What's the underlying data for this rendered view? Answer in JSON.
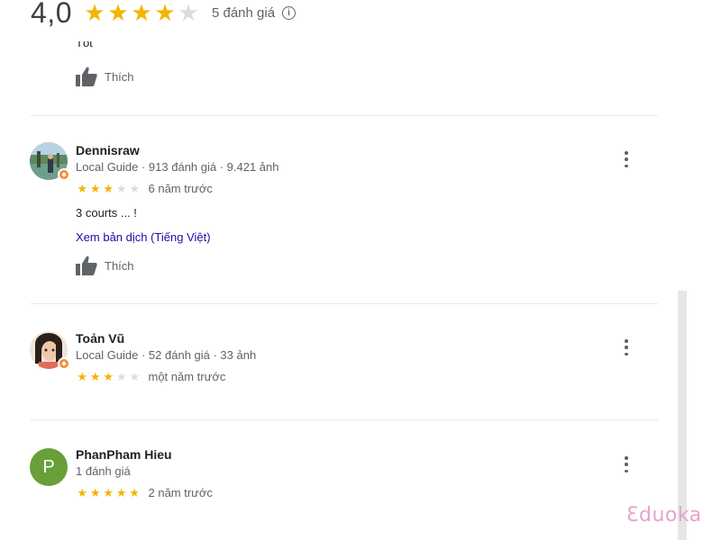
{
  "summary": {
    "score": "4,0",
    "rating": 4,
    "count_label": "5 đánh giá",
    "info_icon": "info-circle-icon"
  },
  "cut_review_text": "Tốt",
  "like_label": "Thích",
  "reviews": [
    {
      "name": "Dennisraw",
      "meta": "Local Guide · 913 đánh giá · 9.421 ảnh",
      "rating": 3,
      "time": "6 năm trước",
      "text": "3 courts ... !",
      "translate": "Xem bản dịch (Tiếng Việt)"
    },
    {
      "name": "Toản Vũ",
      "meta": "Local Guide · 52 đánh giá · 33 ảnh",
      "rating": 3,
      "time": "một năm trước"
    },
    {
      "name": "PhanPham Hieu",
      "avatar_letter": "P",
      "meta": "1 đánh giá",
      "rating": 5,
      "time": "2 năm trước"
    }
  ],
  "watermark": "Ɛduoka",
  "colors": {
    "star_on": "#f4b400",
    "star_off": "#dadce0",
    "link": "#1a0dab",
    "avatar_p": "#689f38"
  }
}
